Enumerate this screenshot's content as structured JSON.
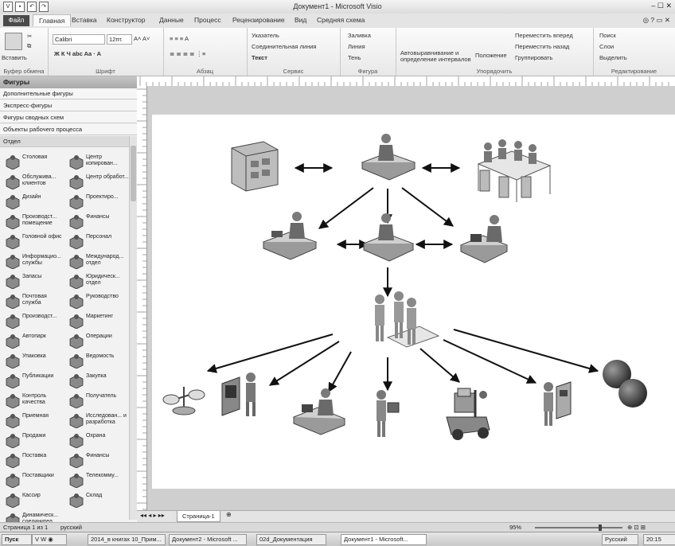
{
  "window": {
    "title": "Документ1 - Microsoft Visio",
    "controls": "– ☐ ✕"
  },
  "ribbon_tabs": [
    "Файл",
    "Главная",
    "Вставка",
    "Конструктор",
    "Данные",
    "Процесс",
    "Рецензирование",
    "Вид",
    "Средняя схема"
  ],
  "ribbon": {
    "clipboard": {
      "paste": "Вставить",
      "label": "Буфер обмена"
    },
    "font": {
      "name": "Calibri",
      "size": "12пт.",
      "label": "Шрифт"
    },
    "paragraph": {
      "label": "Абзац"
    },
    "tools": {
      "pointer": "Указатель",
      "connector": "Соединительная линия",
      "text": "Текст",
      "label": "Сервис"
    },
    "shape": {
      "fill": "Заливка",
      "line": "Линия",
      "shadow": "Тень",
      "label": "Фигура"
    },
    "arrange": {
      "auto_align": "Автовыравнивание и определение интервалов",
      "position": "Положение",
      "bring_forward": "Переместить вперед",
      "send_back": "Переместить назад",
      "group": "Группировать",
      "label": "Упорядочить"
    },
    "editing": {
      "find": "Поиск",
      "layers": "Слои",
      "select": "Выделить",
      "label": "Редактирование"
    }
  },
  "shapes_panel": {
    "title": "Фигуры",
    "categories": [
      "Дополнительные фигуры",
      "Экспресс-фигуры",
      "Фигуры сводных схем",
      "Объекты рабочего процесса",
      "Отдел"
    ],
    "items": [
      {
        "label": "Столовая",
        "icon": "cafeteria-icon"
      },
      {
        "label": "Центр копирован...",
        "icon": "copy-center-icon"
      },
      {
        "label": "Обслужива... клиентов",
        "icon": "customer-service-icon"
      },
      {
        "label": "Центр обработ...",
        "icon": "processing-center-icon"
      },
      {
        "label": "Дизайн",
        "icon": "design-icon"
      },
      {
        "label": "Проектиро...",
        "icon": "engineering-icon"
      },
      {
        "label": "Производст... помещение",
        "icon": "facilities-icon"
      },
      {
        "label": "Финансы",
        "icon": "finance-icon"
      },
      {
        "label": "Головной офис",
        "icon": "headquarters-icon"
      },
      {
        "label": "Персонал",
        "icon": "personnel-icon"
      },
      {
        "label": "Информацио... службы",
        "icon": "info-services-icon"
      },
      {
        "label": "Международ... отдел",
        "icon": "international-icon"
      },
      {
        "label": "Запасы",
        "icon": "inventory-icon"
      },
      {
        "label": "Юридическ... отдел",
        "icon": "legal-icon"
      },
      {
        "label": "Почтовая служба",
        "icon": "mail-icon"
      },
      {
        "label": "Руководство",
        "icon": "management-icon"
      },
      {
        "label": "Производст...",
        "icon": "manufacturing-icon"
      },
      {
        "label": "Маркетинг",
        "icon": "marketing-icon"
      },
      {
        "label": "Автопарк",
        "icon": "motor-pool-icon"
      },
      {
        "label": "Операции",
        "icon": "operations-icon"
      },
      {
        "label": "Упаковка",
        "icon": "packaging-icon"
      },
      {
        "label": "Ведомость",
        "icon": "payroll-icon"
      },
      {
        "label": "Публикации",
        "icon": "publications-icon"
      },
      {
        "label": "Закупка",
        "icon": "purchasing-icon"
      },
      {
        "label": "Контроль качества",
        "icon": "quality-icon"
      },
      {
        "label": "Получатель",
        "icon": "receiving-icon"
      },
      {
        "label": "Приемная",
        "icon": "reception-icon"
      },
      {
        "label": "Исследован... и разработка",
        "icon": "research-icon"
      },
      {
        "label": "Продажи",
        "icon": "sales-icon"
      },
      {
        "label": "Охрана",
        "icon": "security-icon"
      },
      {
        "label": "Поставка",
        "icon": "shipping-icon"
      },
      {
        "label": "Финансы",
        "icon": "finance2-icon"
      },
      {
        "label": "Поставщики",
        "icon": "suppliers-icon"
      },
      {
        "label": "Телекомму...",
        "icon": "telecom-icon"
      },
      {
        "label": "Кассир",
        "icon": "cashier-icon"
      },
      {
        "label": "Склад",
        "icon": "warehouse-icon"
      },
      {
        "label": "Динамическ... соединител...",
        "icon": "dynamic-connector-icon"
      }
    ]
  },
  "page_tab": "Страница-1",
  "status": {
    "page": "Страница 1 из 1",
    "lang": "русский",
    "zoom": "95%"
  },
  "taskbar": {
    "start": "Пуск",
    "items": [
      "2014_в книгах 10_Прим...",
      "Документ2 - Microsoft ...",
      "02d_Документация",
      "Документ1 - Microsoft..."
    ],
    "lang": "Русский",
    "time": "20:15"
  }
}
